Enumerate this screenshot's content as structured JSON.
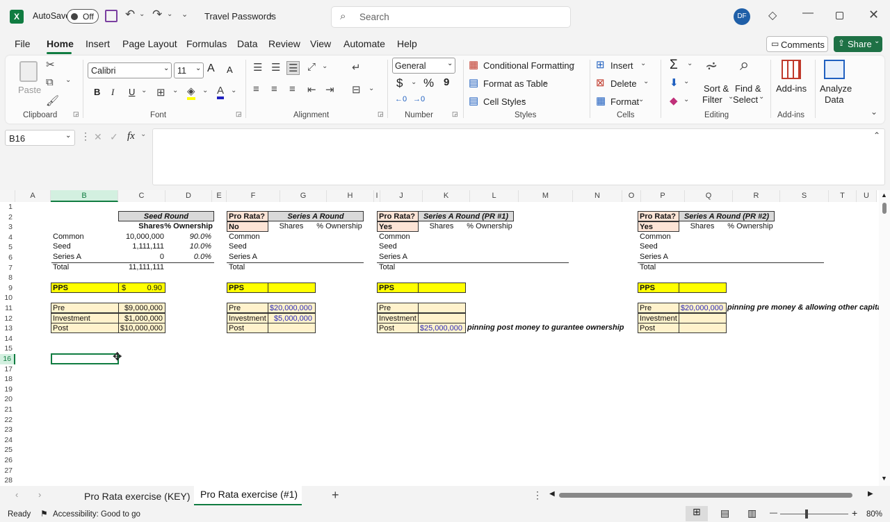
{
  "titlebar": {
    "autosave_label": "AutoSave",
    "autosave_state": "Off",
    "file_title": "Travel Passwords",
    "search_placeholder": "Search",
    "user_initials": "DF"
  },
  "menu": {
    "items": [
      "File",
      "Home",
      "Insert",
      "Page Layout",
      "Formulas",
      "Data",
      "Review",
      "View",
      "Automate",
      "Help"
    ],
    "active": "Home",
    "comments_label": "Comments",
    "share_label": "Share"
  },
  "ribbon": {
    "clipboard": {
      "paste": "Paste",
      "group": "Clipboard"
    },
    "font": {
      "name": "Calibri",
      "size": "11",
      "bold": "B",
      "italic": "I",
      "underline": "U",
      "grow": "A",
      "shrink": "A",
      "group": "Font"
    },
    "alignment": {
      "group": "Alignment"
    },
    "number": {
      "format": "General",
      "currency": "$",
      "percent": "%",
      "comma": "9",
      "group": "Number"
    },
    "styles": {
      "conditional": "Conditional Formatting",
      "format_table": "Format as Table",
      "cell_styles": "Cell Styles",
      "group": "Styles"
    },
    "cells": {
      "insert": "Insert",
      "delete": "Delete",
      "format": "Format",
      "group": "Cells"
    },
    "editing": {
      "sigma": "Σ",
      "sort": "Sort &",
      "filter": "Filter",
      "find": "Find &",
      "select": "Select",
      "group": "Editing"
    },
    "addins": {
      "label": "Add-ins",
      "group": "Add-ins"
    },
    "analyze": {
      "line1": "Analyze",
      "line2": "Data"
    }
  },
  "formula_bar": {
    "name_box": "B16",
    "fx": "fx",
    "value": ""
  },
  "columns": [
    "A",
    "B",
    "C",
    "D",
    "E",
    "F",
    "G",
    "H",
    "I",
    "J",
    "K",
    "L",
    "M",
    "N",
    "O",
    "P",
    "Q",
    "R",
    "S",
    "T",
    "U"
  ],
  "rows": [
    "1",
    "2",
    "3",
    "4",
    "5",
    "6",
    "7",
    "8",
    "9",
    "10",
    "11",
    "12",
    "13",
    "14",
    "15",
    "16",
    "17",
    "18",
    "19",
    "20",
    "21",
    "22",
    "23",
    "24",
    "25",
    "26",
    "27",
    "28"
  ],
  "sheet": {
    "seed": {
      "title": "Seed Round",
      "shares": "Shares",
      "own": "% Ownership",
      "rows": [
        [
          "Common",
          "10,000,000",
          "90.0%"
        ],
        [
          "Seed",
          "1,111,111",
          "10.0%"
        ],
        [
          "Series A",
          "0",
          "0.0%"
        ]
      ],
      "total_label": "Total",
      "total": "11,111,111",
      "pps": "PPS",
      "pps_sym": "$",
      "pps_val": "0.90",
      "pre": "Pre",
      "pre_val": "$9,000,000",
      "inv": "Investment",
      "inv_val": "$1,000,000",
      "post": "Post",
      "post_val": "$10,000,000"
    },
    "a1": {
      "q": "Pro Rata?",
      "ans": "No",
      "title": "Series A Round",
      "shares": "Shares",
      "own": "% Ownership",
      "labels": [
        "Common",
        "Seed",
        "Series A"
      ],
      "total_label": "Total",
      "pps": "PPS",
      "pre": "Pre",
      "pre_val": "$20,000,000",
      "inv": "Investment",
      "inv_val": "$5,000,000",
      "post": "Post"
    },
    "a2": {
      "q": "Pro Rata?",
      "ans": "Yes",
      "title": "Series A Round (PR #1)",
      "shares": "Shares",
      "own": "% Ownership",
      "labels": [
        "Common",
        "Seed",
        "Series A"
      ],
      "total_label": "Total",
      "pps": "PPS",
      "pre": "Pre",
      "inv": "Investment",
      "post": "Post",
      "post_val": "$25,000,000",
      "note": "pinning post money to gurantee ownership"
    },
    "a3": {
      "q": "Pro Rata?",
      "ans": "Yes",
      "title": "Series A Round (PR #2)",
      "shares": "Shares",
      "own": "% Ownership",
      "labels": [
        "Common",
        "Seed",
        "Series A"
      ],
      "total_label": "Total",
      "pps": "PPS",
      "pre": "Pre",
      "pre_val": "$20,000,000",
      "inv": "Investment",
      "post": "Post",
      "note": "pinning pre money & allowing other capita"
    }
  },
  "tabs": {
    "items": [
      "Pro Rata exercise (KEY)",
      "Pro Rata exercise (#1)"
    ],
    "active": "Pro Rata exercise (#1)",
    "add": "+"
  },
  "status": {
    "ready": "Ready",
    "accessibility": "Accessibility: Good to go",
    "zoom": "80%",
    "minus": "—",
    "plus": "+"
  },
  "colors": {
    "excel_green": "#107c41",
    "share_green": "#1e7145",
    "seed_header": "#d9d9d9",
    "pro_rata_cell": "#fce4d6",
    "pps_yellow": "#ffff00",
    "value_cream": "#fff2cc"
  }
}
